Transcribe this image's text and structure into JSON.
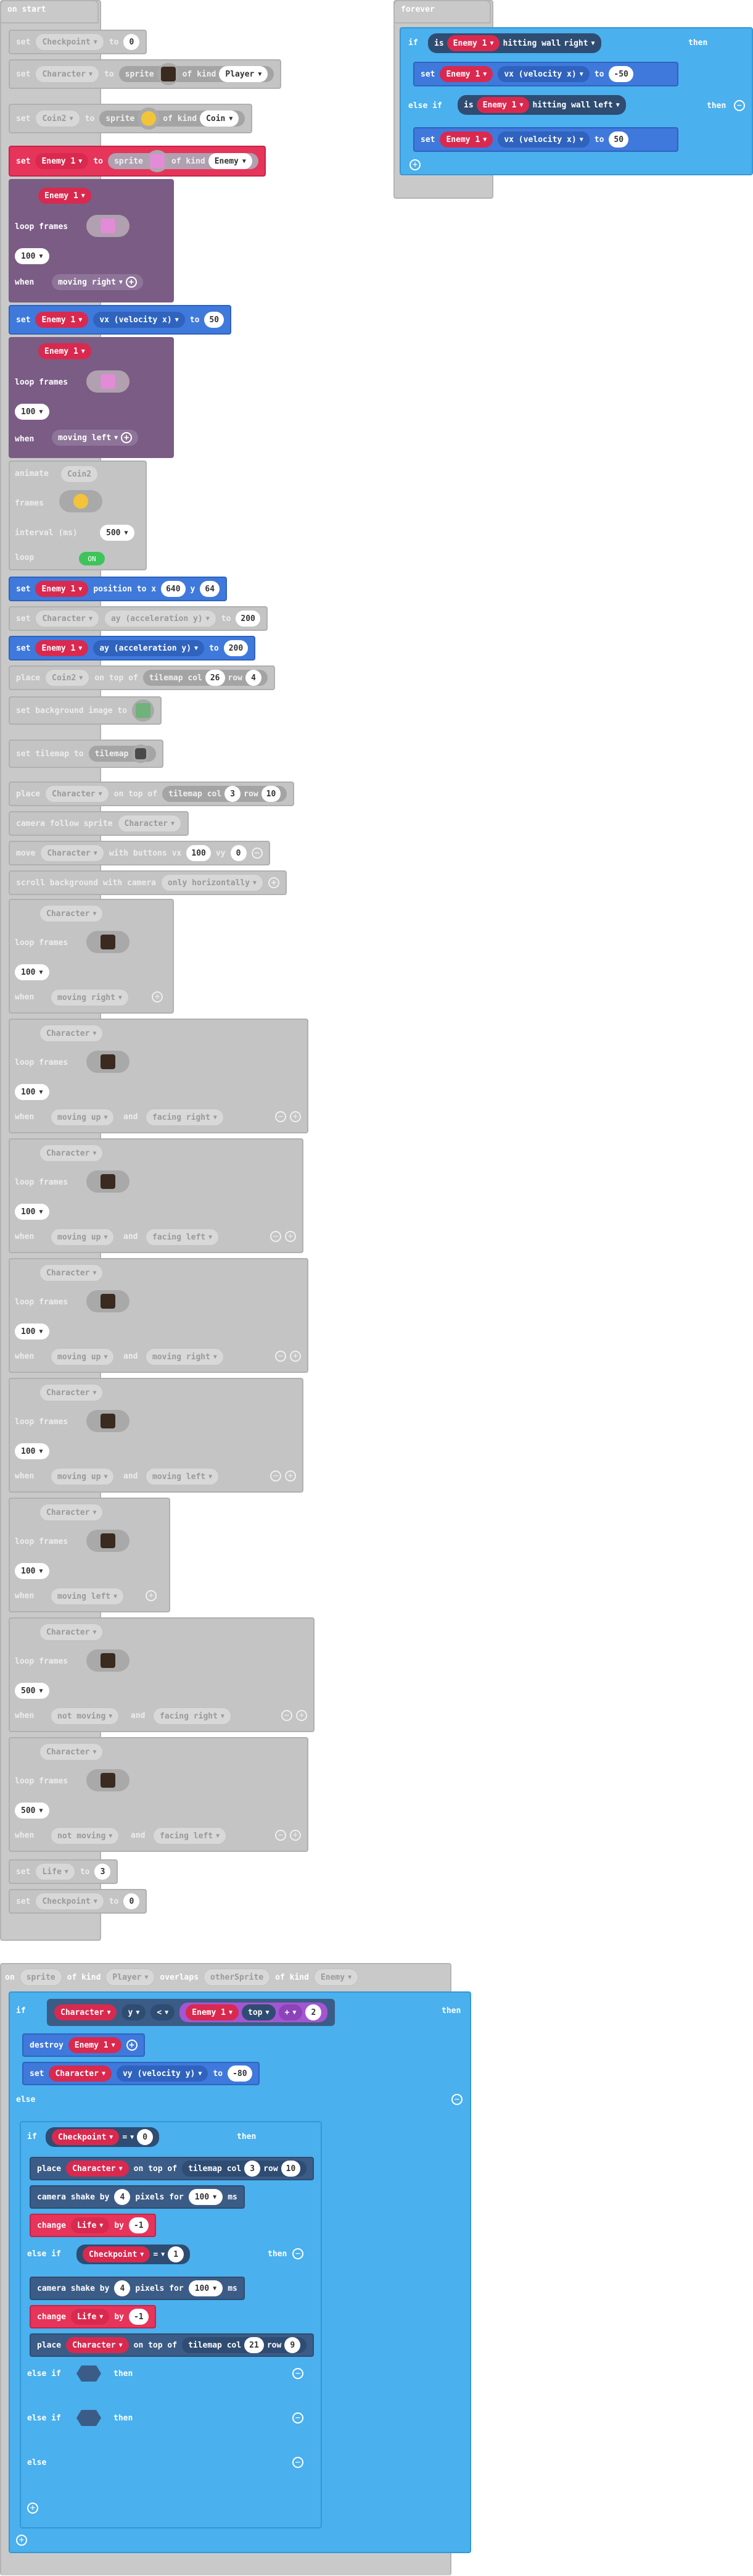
{
  "on_start": {
    "title": "on start",
    "checkpoint_set": {
      "set": "set",
      "var": "Checkpoint",
      "to": "to",
      "value": "0"
    },
    "character_set": {
      "set": "set",
      "var": "Character",
      "to": "to",
      "sprite": "sprite",
      "of_kind": "of kind",
      "kind": "Player"
    },
    "coin_set": {
      "set": "set",
      "var": "Coin2",
      "to": "to",
      "sprite": "sprite",
      "of_kind": "of kind",
      "kind": "Coin"
    },
    "enemy_set": {
      "set": "set",
      "var": "Enemy 1",
      "to": "to",
      "sprite": "sprite",
      "of_kind": "of kind",
      "kind": "Enemy"
    },
    "anim1": {
      "sprite": "Enemy 1",
      "loop_frames": "loop frames",
      "interval": "100",
      "when": "when",
      "state": "moving right"
    },
    "vx_set": {
      "set": "set",
      "sprite": "Enemy 1",
      "prop": "vx (velocity x)",
      "to": "to",
      "value": "50"
    },
    "anim2": {
      "sprite": "Enemy 1",
      "loop_frames": "loop frames",
      "interval": "100",
      "when": "when",
      "state": "moving left"
    },
    "animate_coin": {
      "animate": "animate",
      "sprite": "Coin2",
      "frames": "frames",
      "interval_label": "interval (ms)",
      "interval": "500",
      "loop": "loop",
      "on": "ON"
    },
    "pos_set": {
      "set": "set",
      "sprite": "Enemy 1",
      "text": "position to x",
      "x": "640",
      "y_label": "y",
      "y": "64"
    },
    "ay_char": {
      "set": "set",
      "sprite": "Character",
      "prop": "ay (acceleration y)",
      "to": "to",
      "value": "200"
    },
    "ay_enemy": {
      "set": "set",
      "sprite": "Enemy 1",
      "prop": "ay (acceleration y)",
      "to": "to",
      "value": "200"
    },
    "place_coin": {
      "place": "place",
      "sprite": "Coin2",
      "on_top": "on top of",
      "tilemap": "tilemap col",
      "col": "26",
      "row_label": "row",
      "row": "4"
    },
    "bg_image": {
      "text": "set background image to"
    },
    "set_tilemap": {
      "text": "set tilemap to",
      "tilemap": "tilemap"
    },
    "place_char": {
      "place": "place",
      "sprite": "Character",
      "on_top": "on top of",
      "tilemap": "tilemap col",
      "col": "3",
      "row_label": "row",
      "row": "10"
    },
    "camera": {
      "text": "camera follow sprite",
      "sprite": "Character"
    },
    "move": {
      "move": "move",
      "sprite": "Character",
      "with": "with buttons",
      "vx_label": "vx",
      "vx": "100",
      "vy_label": "vy",
      "vy": "0"
    },
    "scroll": {
      "text": "scroll background with camera",
      "mode": "only horizontally"
    },
    "char_anims": [
      {
        "sprite": "Character",
        "loop_frames": "loop frames",
        "interval": "100",
        "when": "when",
        "state": "moving right",
        "and": "",
        "state2": ""
      },
      {
        "sprite": "Character",
        "loop_frames": "loop frames",
        "interval": "100",
        "when": "when",
        "state": "moving up",
        "and": "and",
        "state2": "facing right"
      },
      {
        "sprite": "Character",
        "loop_frames": "loop frames",
        "interval": "100",
        "when": "when",
        "state": "moving up",
        "and": "and",
        "state2": "facing left"
      },
      {
        "sprite": "Character",
        "loop_frames": "loop frames",
        "interval": "100",
        "when": "when",
        "state": "moving up",
        "and": "and",
        "state2": "moving right"
      },
      {
        "sprite": "Character",
        "loop_frames": "loop frames",
        "interval": "100",
        "when": "when",
        "state": "moving up",
        "and": "and",
        "state2": "moving left"
      },
      {
        "sprite": "Character",
        "loop_frames": "loop frames",
        "interval": "100",
        "when": "when",
        "state": "moving left",
        "and": "",
        "state2": ""
      },
      {
        "sprite": "Character",
        "loop_frames": "loop frames",
        "interval": "500",
        "when": "when",
        "state": "not moving",
        "and": "and",
        "state2": "facing right"
      },
      {
        "sprite": "Character",
        "loop_frames": "loop frames",
        "interval": "500",
        "when": "when",
        "state": "not moving",
        "and": "and",
        "state2": "facing left"
      }
    ],
    "life_set": {
      "set": "set",
      "var": "Life",
      "to": "to",
      "value": "3"
    },
    "checkpoint_set2": {
      "set": "set",
      "var": "Checkpoint",
      "to": "to",
      "value": "0"
    }
  },
  "forever": {
    "title": "forever",
    "if": "if",
    "is": "is",
    "sprite": "Enemy 1",
    "hitting": "hitting wall",
    "right": "right",
    "then": "then",
    "set": "set",
    "prop": "vx (velocity x)",
    "to": "to",
    "val1": "-50",
    "else_if": "else if",
    "left": "left",
    "val2": "50"
  },
  "overlap": {
    "on": "on",
    "sprite_var": "sprite",
    "of_kind": "of kind",
    "kind1": "Player",
    "overlaps": "overlaps",
    "other": "otherSprite",
    "kind2": "Enemy",
    "if": "if",
    "char": "Character",
    "y": "y",
    "lt": "<",
    "enemy": "Enemy 1",
    "top": "top",
    "plus": "+",
    "two": "2",
    "then": "then",
    "destroy": "destroy",
    "set": "set",
    "vy": "vy (velocity y)",
    "to": "to",
    "vy_val": "-80",
    "else": "else",
    "checkpoint": "Checkpoint",
    "eq": "=",
    "zero": "0",
    "one": "1",
    "place": "place",
    "on_top": "on top of",
    "tilemap": "tilemap col",
    "row": "row",
    "col3": "3",
    "row10": "10",
    "col21": "21",
    "row9": "9",
    "shake": "camera shake by",
    "shake_val": "4",
    "pixels": "pixels for",
    "ms_val": "100",
    "ms": "ms",
    "change": "change",
    "life": "Life",
    "by": "by",
    "minus1": "-1",
    "else_if": "else if"
  }
}
